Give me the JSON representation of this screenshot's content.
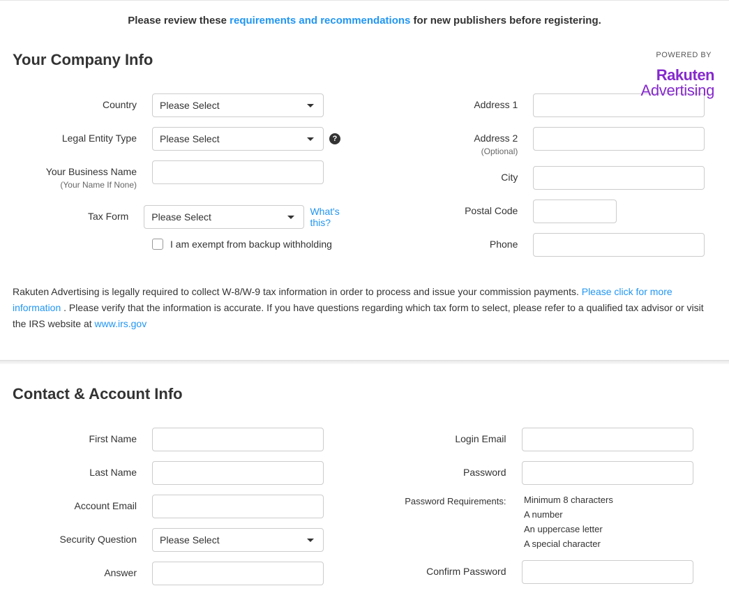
{
  "notice": {
    "prefix": "Please review these ",
    "link": "requirements and recommendations",
    "suffix": " for new publishers before registering."
  },
  "powered_by": "POWERED BY",
  "logo": {
    "brand": "Rakuten",
    "sub": "Advertising"
  },
  "section1": {
    "title": "Your Company Info",
    "country_label": "Country",
    "country_placeholder": "Please Select",
    "legal_entity_label": "Legal Entity Type",
    "legal_entity_placeholder": "Please Select",
    "business_name_label": "Your Business Name",
    "business_name_sub": "(Your Name If None)",
    "tax_form_label": "Tax Form",
    "tax_form_placeholder": "Please Select",
    "whats_this": "What's this?",
    "exempt_label": "I am exempt from backup withholding",
    "address1_label": "Address 1",
    "address2_label": "Address 2",
    "address2_sub": "(Optional)",
    "city_label": "City",
    "postal_label": "Postal Code",
    "phone_label": "Phone"
  },
  "disclaimer": {
    "t1": "Rakuten Advertising is legally required to collect W-8/W-9 tax information in order to process and issue your commission payments. ",
    "link1": "Please click for more information",
    "t2": " . Please verify that the information is accurate. If you have questions regarding which tax form to select, please refer to a qualified tax advisor or visit the IRS website at ",
    "link2": "www.irs.gov"
  },
  "section2": {
    "title": "Contact & Account Info",
    "first_name_label": "First Name",
    "last_name_label": "Last Name",
    "account_email_label": "Account Email",
    "security_q_label": "Security Question",
    "security_q_placeholder": "Please Select",
    "answer_label": "Answer",
    "login_email_label": "Login Email",
    "password_label": "Password",
    "pw_req_label": "Password Requirements:",
    "pw_reqs": [
      "Minimum 8 characters",
      "A number",
      "An uppercase letter",
      "A special character"
    ],
    "confirm_pw_label": "Confirm Password"
  }
}
